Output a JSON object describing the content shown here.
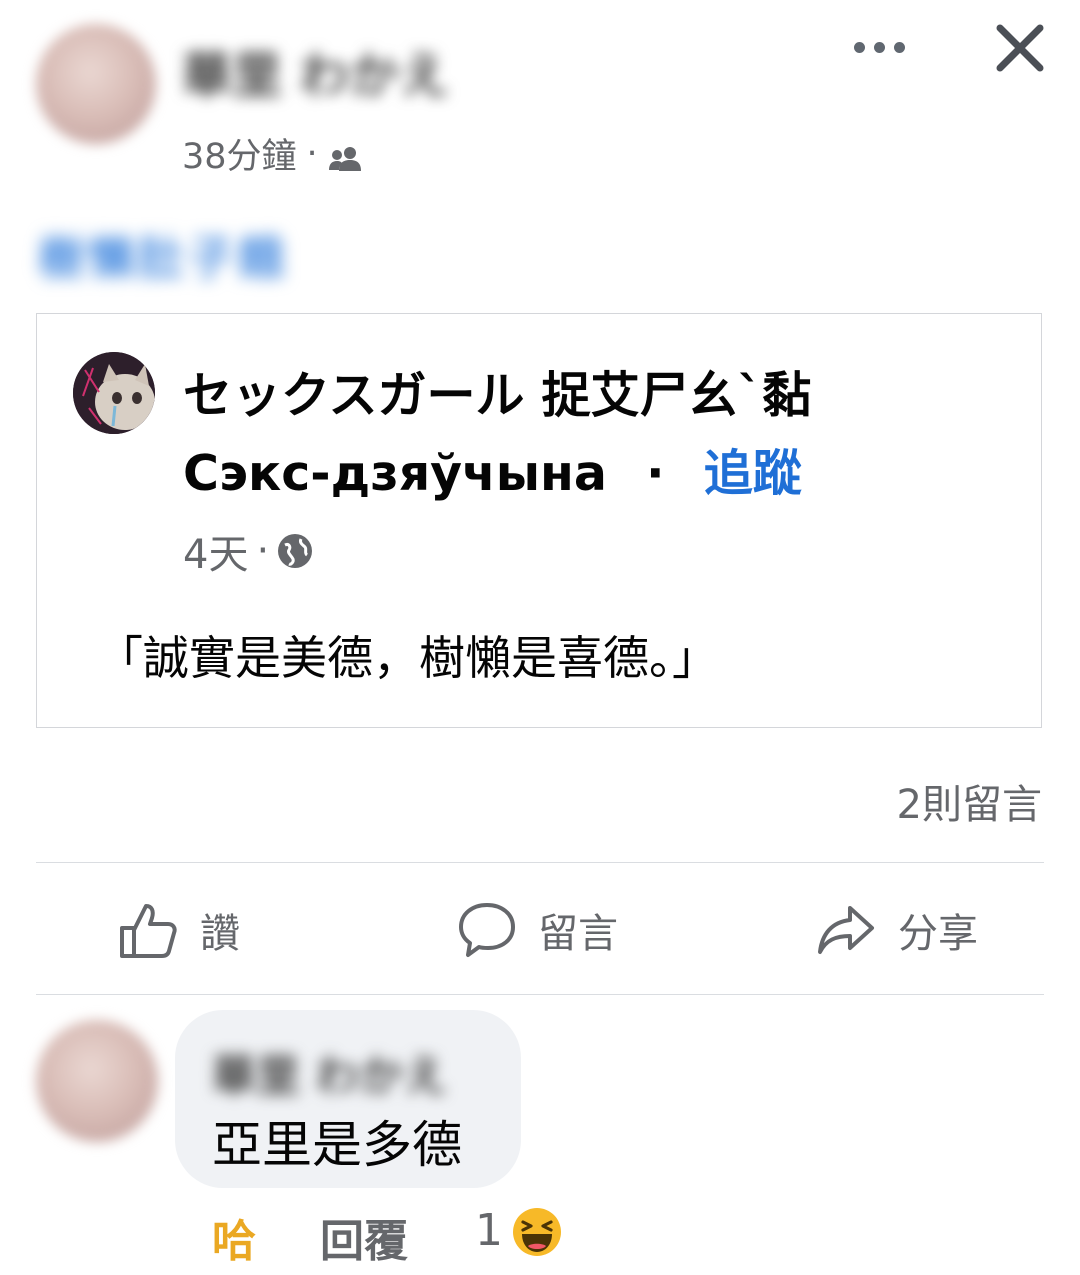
{
  "post": {
    "author_name": "華里 わかえ",
    "time": "38分鐘",
    "time_sep": "·",
    "audience_icon": "friends-icon",
    "caption": "樹懶肚子餓",
    "more_icon": "more-dots-icon",
    "close_icon": "close-icon"
  },
  "shared": {
    "page_name": "セックスガール 捉艾尸幺`黏",
    "page_sub": "Сэкс-дзяўчына",
    "dot": "·",
    "follow": "追蹤",
    "time": "4天",
    "time_sep": "·",
    "audience_icon": "globe-icon",
    "quote": "「誠實是美德，樹懶是喜德。」"
  },
  "stats": {
    "comment_count": "2則留言"
  },
  "actions": {
    "like": "讚",
    "comment": "留言",
    "share": "分享"
  },
  "comment": {
    "author_name": "華里 わかえ",
    "text": "亞里是多德",
    "reaction_label": "哈",
    "reply_label": "回覆",
    "reaction_count": "1",
    "reaction_icon": "haha-emoji-icon"
  },
  "colors": {
    "link_blue": "#1f6fd6",
    "meta_gray": "#65676b",
    "haha_yellow": "#eaa823"
  }
}
